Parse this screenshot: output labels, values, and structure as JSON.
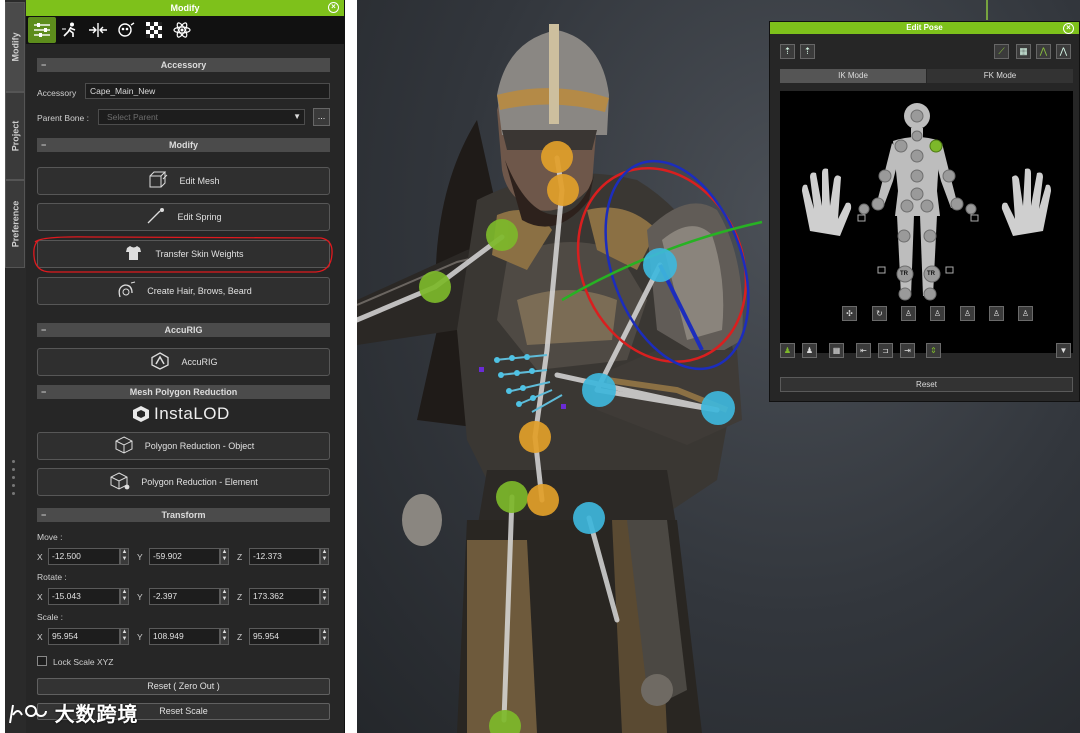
{
  "side_tabs": [
    "Modify",
    "Project",
    "Preference"
  ],
  "modify_panel": {
    "title": "Modify",
    "tab_icons": [
      "sliders-icon",
      "motion-icon",
      "align-icon",
      "morph-icon",
      "checker-icon",
      "physics-icon"
    ],
    "accessory_section": "Accessory",
    "accessory_label": "Accessory",
    "accessory_value": "Cape_Main_New",
    "parent_bone_label": "Parent Bone :",
    "parent_bone_placeholder": "Select Parent",
    "more_button": "...",
    "modify_section": "Modify",
    "buttons": {
      "edit_mesh": "Edit Mesh",
      "edit_spring": "Edit Spring",
      "transfer_skin_weights": "Transfer Skin Weights",
      "create_hair": "Create Hair, Brows, Beard"
    },
    "accurig_section": "AccuRIG",
    "accurig_button": "AccuRIG",
    "mesh_reduction_section": "Mesh Polygon Reduction",
    "instalod_logo": "InstaLOD",
    "polygon_object": "Polygon Reduction - Object",
    "polygon_element": "Polygon Reduction - Element",
    "transform_section": "Transform",
    "move_label": "Move :",
    "rotate_label": "Rotate :",
    "scale_label": "Scale :",
    "axis_labels": [
      "X",
      "Y",
      "Z"
    ],
    "move": [
      "-12.500",
      "-59.902",
      "-12.373"
    ],
    "rotate": [
      "-15.043",
      "-2.397",
      "173.362"
    ],
    "scale": [
      "95.954",
      "108.949",
      "95.954"
    ],
    "lock_scale_label": "Lock Scale XYZ",
    "reset_zero_out": "Reset ( Zero Out )",
    "reset_scale": "Reset Scale",
    "highlight_color": "#e0191e",
    "accent_color": "#7ec11b"
  },
  "edit_pose": {
    "title": "Edit Pose",
    "ik_mode": "IK Mode",
    "fk_mode": "FK Mode",
    "tr_label": "TR",
    "reset": "Reset"
  },
  "watermark": "大数跨境"
}
